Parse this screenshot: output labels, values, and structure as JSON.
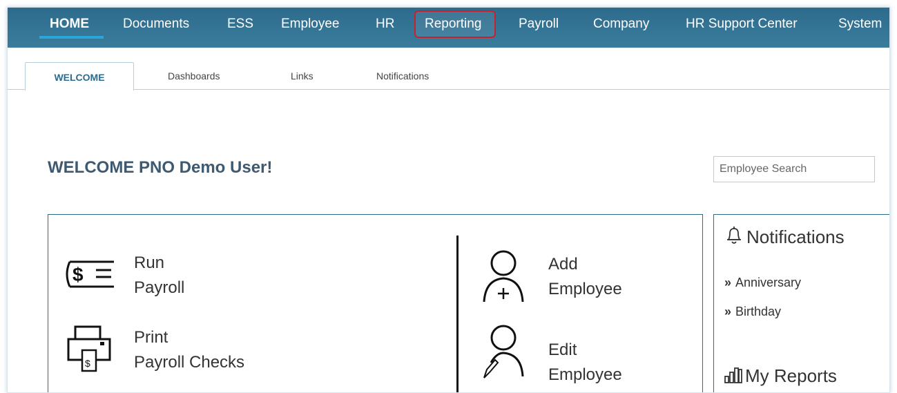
{
  "nav": {
    "items": [
      {
        "label": "HOME"
      },
      {
        "label": "Documents"
      },
      {
        "label": "ESS"
      },
      {
        "label": "Employee"
      },
      {
        "label": "HR"
      },
      {
        "label": "Reporting"
      },
      {
        "label": "Payroll"
      },
      {
        "label": "Company"
      },
      {
        "label": "HR Support Center"
      },
      {
        "label": "System"
      }
    ],
    "active": "HOME",
    "highlighted": "Reporting",
    "colors": {
      "bar": "#2d6b8c",
      "underline": "#2aa7d9",
      "highlight_border": "#cc1f2e"
    }
  },
  "subtabs": [
    {
      "label": "WELCOME"
    },
    {
      "label": "Dashboards"
    },
    {
      "label": "Links"
    },
    {
      "label": "Notifications"
    }
  ],
  "welcome": {
    "title": "WELCOME PNO Demo User!"
  },
  "search": {
    "placeholder": "Employee Search"
  },
  "actions": {
    "run_payroll": {
      "line1": "Run",
      "line2": "Payroll",
      "icon": "payroll-dollar-icon"
    },
    "print_checks": {
      "line1": "Print",
      "line2": "Payroll Checks",
      "icon": "printer-icon"
    },
    "add_employee": {
      "line1": "Add",
      "line2": "Employee",
      "icon": "add-person-icon"
    },
    "edit_employee": {
      "line1": "Edit",
      "line2": "Employee",
      "icon": "edit-person-icon"
    }
  },
  "notifications": {
    "title": "Notifications",
    "icon": "bell-icon",
    "links": [
      {
        "label": "Anniversary"
      },
      {
        "label": "Birthday"
      }
    ]
  },
  "reports": {
    "title": "My Reports",
    "icon": "bar-chart-icon"
  }
}
